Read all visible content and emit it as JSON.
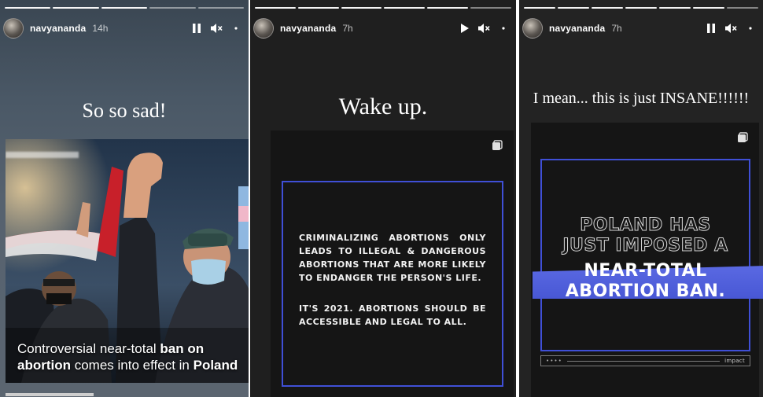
{
  "stories": [
    {
      "username": "navyananda",
      "time": "14h",
      "caption": "So so sad!",
      "news": {
        "pre1": "Controversial near-total ",
        "bold1": "ban on abortion",
        "mid": " comes into effect in ",
        "bold2": "Poland"
      },
      "controls": [
        "pause-icon",
        "mute-icon",
        "more-icon"
      ]
    },
    {
      "username": "navyananda",
      "time": "7h",
      "caption": "Wake up.",
      "statement_1": "CRIMINALIZING ABORTIONS ONLY LEADS TO ILLEGAL & DANGEROUS ABORTIONS THAT ARE MORE LIKELY TO ENDANGER THE PERSON'S LIFE.",
      "statement_2": "IT'S 2021. ABORTIONS SHOULD BE ACCESSIBLE AND LEGAL TO ALL.",
      "controls": [
        "play-icon",
        "mute-icon",
        "more-icon"
      ]
    },
    {
      "username": "navyananda",
      "time": "7h",
      "caption": "I mean... this is just INSANE!!!!!!",
      "outline_line_1": "POLAND HAS",
      "outline_line_2": "JUST IMPOSED A",
      "highlight_line_1": "NEAR-TOTAL",
      "highlight_line_2": "ABORTION BAN.",
      "footer_dots": "••••",
      "footer_brand": "impact",
      "controls": [
        "pause-icon",
        "mute-icon",
        "more-icon"
      ]
    }
  ],
  "colors": {
    "accent_frame": "#3f4fd6",
    "highlight_band": "#4c5ce0"
  }
}
